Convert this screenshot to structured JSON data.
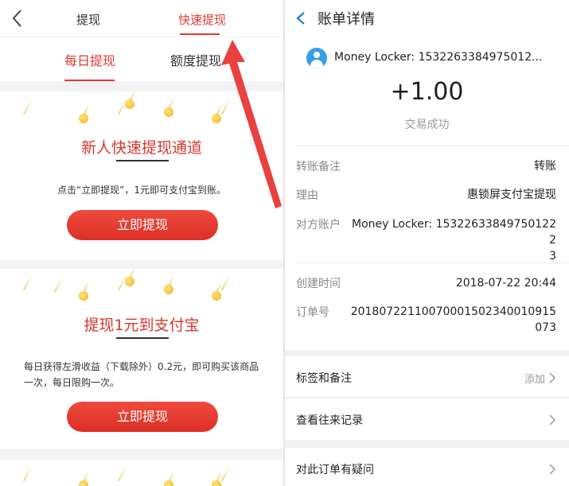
{
  "left": {
    "top_tabs": [
      {
        "label": "提现"
      },
      {
        "label": "快速提现"
      }
    ],
    "sub_tabs": [
      {
        "label": "每日提现"
      },
      {
        "label": "额度提现"
      }
    ],
    "card1": {
      "title": "新人快速提现通道",
      "desc": "点击“立即提现”，1元即可支付宝到账。",
      "button": "立即提现"
    },
    "card2": {
      "title": "提现1元到支付宝",
      "desc": "每日获得左滑收益（下载除外）0.2元，即可购买该商品一次，每日限购一次。",
      "button": "立即提现"
    }
  },
  "right": {
    "header_title": "账单详情",
    "payee_name": "Money Locker: 1532263384975012...",
    "amount": "+1.00",
    "status": "交易成功",
    "details": [
      {
        "label": "转账备注",
        "value": "转账"
      },
      {
        "label": "理由",
        "value": "惠锁屏支付宝提现"
      },
      {
        "label": "对方账户",
        "value": "Money Locker: 153226338497501222\n3"
      },
      {
        "label": "创建时间",
        "value": "2018-07-22 20:44"
      },
      {
        "label": "订单号",
        "value": "20180722110070001502340010915073"
      }
    ],
    "list": [
      {
        "label": "标签和备注",
        "hint": "添加"
      },
      {
        "label": "查看往来记录",
        "hint": ""
      },
      {
        "label": "对此订单有疑问",
        "hint": ""
      }
    ]
  },
  "colors": {
    "accent_red": "#e23a33",
    "link_blue": "#1a7de0",
    "avatar_blue": "#34a0ea"
  }
}
